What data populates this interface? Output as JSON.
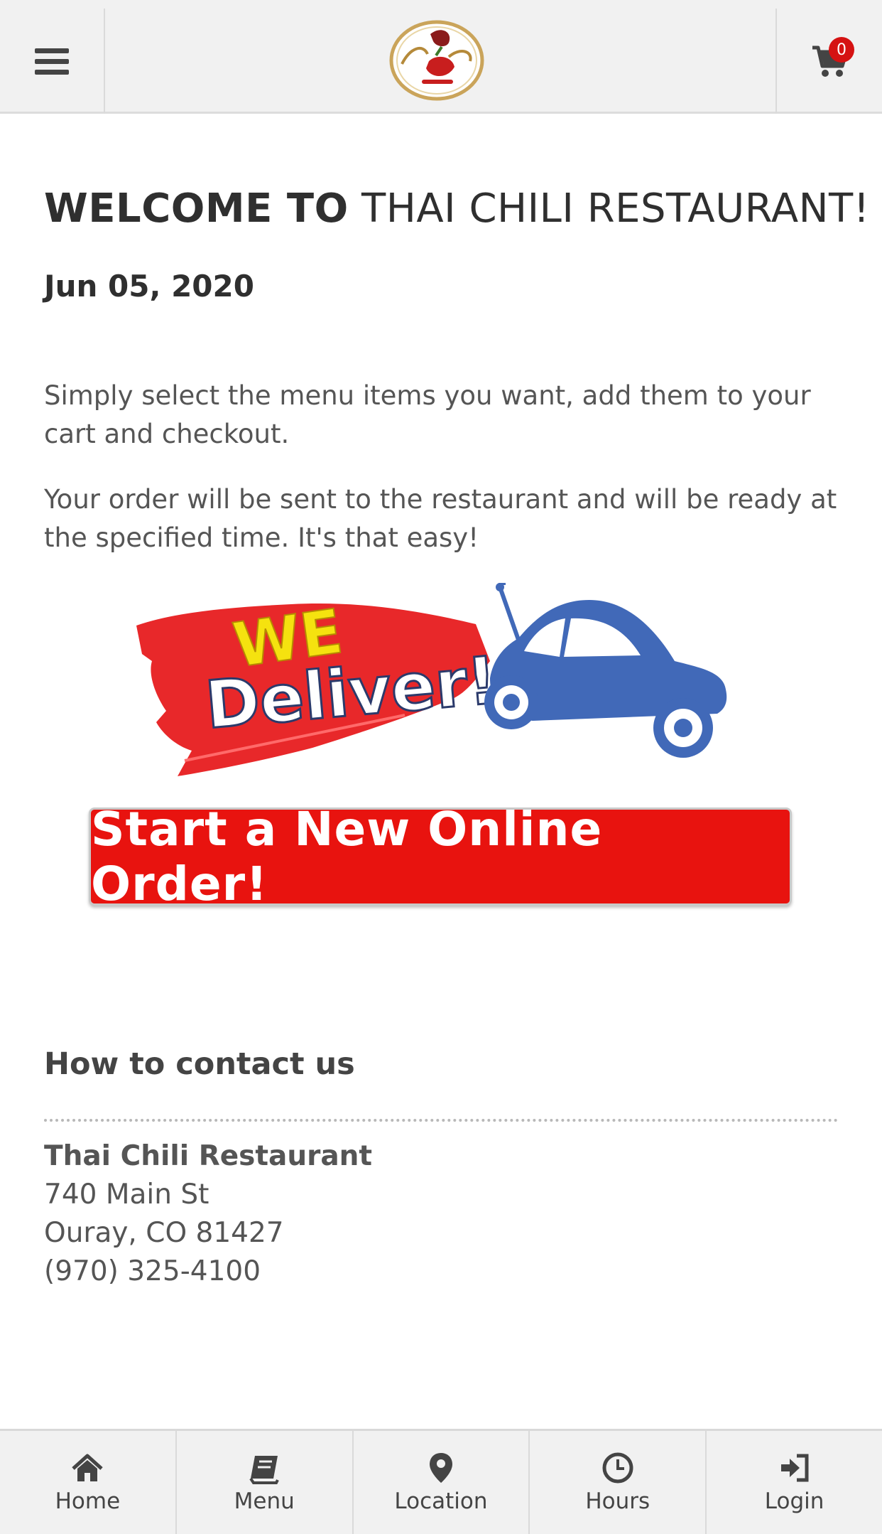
{
  "header": {
    "menu_icon": "hamburger-icon",
    "logo_text": "Thai Chili Restaurant",
    "cart_icon": "shopping-cart-icon",
    "cart_count": "0"
  },
  "welcome": {
    "bold": "WELCOME TO",
    "name": "THAI CHILI RESTAURANT!"
  },
  "date": "Jun 05, 2020",
  "intro": {
    "p1": "Simply select the menu items you want, add them to your cart and checkout.",
    "p2": "Your order will be sent to the restaurant and will be ready at the specified time. It's that easy!"
  },
  "banner": {
    "line1": "WE",
    "line2": "Deliver!"
  },
  "order_button": "Start a New Online Order!",
  "contact": {
    "heading": "How to contact us",
    "name": "Thai Chili Restaurant",
    "street": "740 Main St",
    "city": "Ouray, CO 81427",
    "phone": "(970) 325-4100"
  },
  "nav": [
    {
      "label": "Home",
      "icon": "home-icon"
    },
    {
      "label": "Menu",
      "icon": "book-icon"
    },
    {
      "label": "Location",
      "icon": "map-pin-icon"
    },
    {
      "label": "Hours",
      "icon": "clock-icon"
    },
    {
      "label": "Login",
      "icon": "sign-in-icon"
    }
  ],
  "colors": {
    "accent_red": "#e8130f",
    "badge_red": "#d51212",
    "car_blue": "#4169b8",
    "header_bg": "#f1f1f1"
  }
}
